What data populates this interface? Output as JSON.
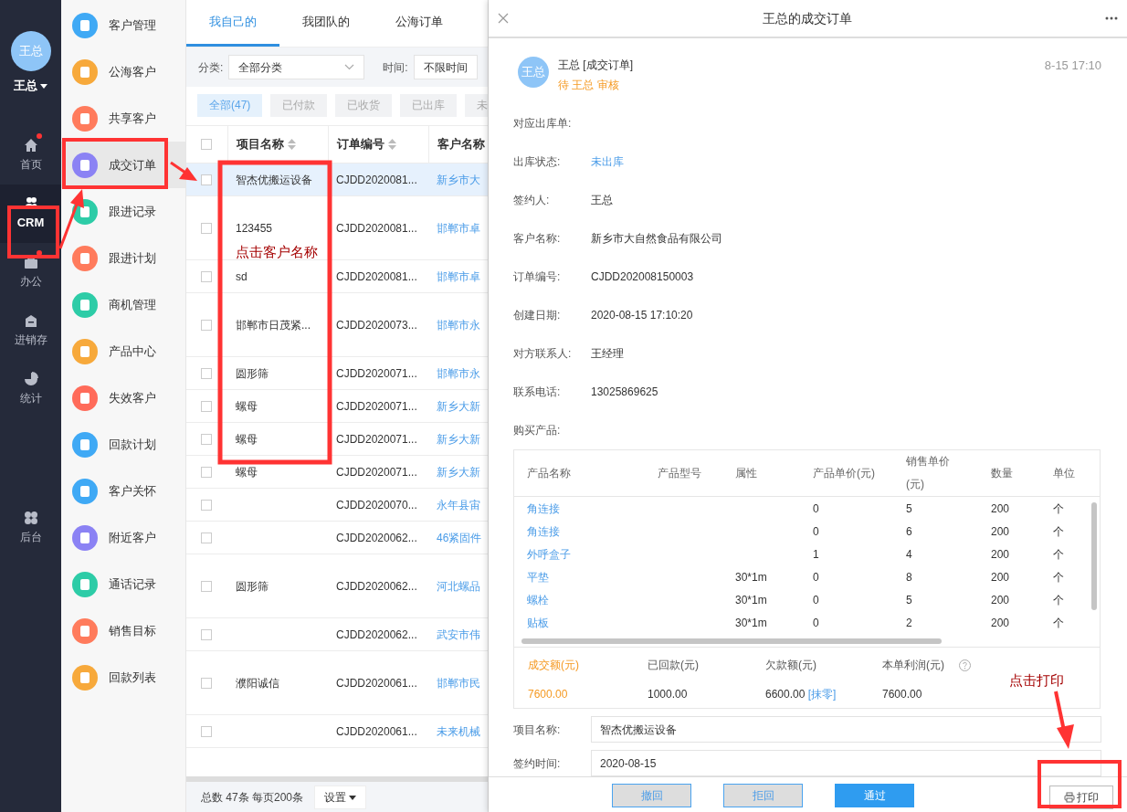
{
  "nav": {
    "avatar": "王总",
    "user": "王总",
    "items": [
      {
        "label": "首页",
        "selected": false,
        "dot": true
      },
      {
        "label": "CRM",
        "selected": true,
        "dot": false
      },
      {
        "label": "办公",
        "selected": false,
        "dot": true
      },
      {
        "label": "进销存",
        "selected": false,
        "dot": false
      },
      {
        "label": "统计",
        "selected": false,
        "dot": false
      },
      {
        "label": "后台",
        "selected": false,
        "dot": false
      }
    ]
  },
  "menu": [
    {
      "label": "客户管理",
      "color": "#3fa9f5",
      "selected": false
    },
    {
      "label": "公海客户",
      "color": "#f7a93b",
      "selected": false
    },
    {
      "label": "共享客户",
      "color": "#ff7b5c",
      "selected": false
    },
    {
      "label": "成交订单",
      "color": "#8b82f4",
      "selected": true
    },
    {
      "label": "跟进记录",
      "color": "#2dcca7",
      "selected": false
    },
    {
      "label": "跟进计划",
      "color": "#ff7b5c",
      "selected": false
    },
    {
      "label": "商机管理",
      "color": "#2dcca7",
      "selected": false
    },
    {
      "label": "产品中心",
      "color": "#f7a93b",
      "selected": false
    },
    {
      "label": "失效客户",
      "color": "#ff6b5a",
      "selected": false
    },
    {
      "label": "回款计划",
      "color": "#3fa9f5",
      "selected": false
    },
    {
      "label": "客户关怀",
      "color": "#3fa9f5",
      "selected": false
    },
    {
      "label": "附近客户",
      "color": "#8b82f4",
      "selected": false
    },
    {
      "label": "通话记录",
      "color": "#2dcca7",
      "selected": false
    },
    {
      "label": "销售目标",
      "color": "#ff7b5c",
      "selected": false
    },
    {
      "label": "回款列表",
      "color": "#f7a93b",
      "selected": false
    }
  ],
  "orders": {
    "tabs": [
      {
        "label": "我自己的",
        "selected": true
      },
      {
        "label": "我团队的",
        "selected": false
      },
      {
        "label": "公海订单",
        "selected": false
      }
    ],
    "filters": [
      {
        "kind": "select",
        "label": "分类:",
        "value": "全部分类"
      },
      {
        "kind": "input",
        "label": "时间:",
        "value": "不限时间"
      }
    ],
    "chips": [
      {
        "label": "全部(47)",
        "selected": true
      },
      {
        "label": "已付款",
        "selected": false
      },
      {
        "label": "已收货",
        "selected": false
      },
      {
        "label": "已出库",
        "selected": false
      },
      {
        "label": "未",
        "selected": false
      }
    ],
    "columns": [
      "项目名称",
      "订单编号",
      "客户名称"
    ],
    "all_checked": false,
    "rows": [
      {
        "name": "智杰优搬运设备",
        "order": "CJDD2020081...",
        "customer": "新乡市大",
        "selected": true,
        "checked": false
      },
      {
        "name": "123455",
        "order": "CJDD2020081...",
        "customer": "邯郸市卓",
        "selected": false,
        "checked": false
      },
      {
        "name": "sd",
        "order": "CJDD2020081...",
        "customer": "邯郸市卓",
        "selected": false,
        "checked": false
      },
      {
        "name": "邯郸市日茂紧...",
        "order": "CJDD2020073...",
        "customer": "邯郸市永",
        "selected": false,
        "checked": false
      },
      {
        "name": "圆形筛",
        "order": "CJDD2020071...",
        "customer": "邯郸市永",
        "selected": false,
        "checked": false
      },
      {
        "name": "螺母",
        "order": "CJDD2020071...",
        "customer": "新乡大新",
        "selected": false,
        "checked": false
      },
      {
        "name": "螺母",
        "order": "CJDD2020071...",
        "customer": "新乡大新",
        "selected": false,
        "checked": false
      },
      {
        "name": "螺母",
        "order": "CJDD2020071...",
        "customer": "新乡大新",
        "selected": false,
        "checked": false
      },
      {
        "order": "CJDD2020070...",
        "customer": "永年县宙",
        "selected": false,
        "checked": false
      },
      {
        "order": "CJDD2020062...",
        "customer": "46紧固件",
        "selected": false,
        "checked": false
      },
      {
        "name": "圆形筛",
        "order": "CJDD2020062...",
        "customer": "河北螺品",
        "selected": false,
        "checked": false
      },
      {
        "order": "CJDD2020062...",
        "customer": "武安市伟",
        "selected": false,
        "checked": false
      },
      {
        "name": "濮阳诚信",
        "order": "CJDD2020061...",
        "customer": "邯郸市民",
        "selected": false,
        "checked": false
      },
      {
        "order": "CJDD2020061...",
        "customer": "未来机械",
        "selected": false,
        "checked": false
      }
    ],
    "footer": {
      "summary": "总数 47条 每页200条",
      "settings": "设置"
    }
  },
  "panel": {
    "title": "王总的成交订单",
    "avatar": "王总",
    "author": "王总 [成交订单]",
    "status": "待 王总 审核",
    "time": "8-15 17:10",
    "fields": [
      {
        "label": "对应出库单:"
      },
      {
        "label": "出库状态:",
        "value": "未出库",
        "kind": "link"
      },
      {
        "label": "签约人:",
        "value": "王总",
        "kind": "text"
      },
      {
        "label": "客户名称:",
        "value": "新乡市大自然食品有限公司",
        "kind": "text"
      },
      {
        "label": "订单编号:",
        "value": "CJDD202008150003",
        "kind": "text"
      },
      {
        "label": "创建日期:",
        "value": "2020-08-15 17:10:20",
        "kind": "text"
      },
      {
        "label": "对方联系人:",
        "value": "王经理",
        "kind": "text"
      },
      {
        "label": "联系电话:",
        "value": "13025869625",
        "kind": "text"
      },
      {
        "label": "购买产品:"
      }
    ],
    "products": {
      "columns": [
        "产品名称",
        "产品型号",
        "属性",
        "产品单价(元)",
        "销售单价(元)",
        "数量",
        "单位"
      ],
      "rows": [
        [
          "角连接",
          "",
          "",
          "0",
          "5",
          "200",
          "个"
        ],
        [
          "角连接",
          "",
          "",
          "0",
          "6",
          "200",
          "个"
        ],
        [
          "外呼盒子",
          "",
          "",
          "1",
          "4",
          "200",
          "个"
        ],
        [
          "平垫",
          "",
          "30*1m",
          "0",
          "8",
          "200",
          "个"
        ],
        [
          "螺栓",
          "",
          "30*1m",
          "0",
          "5",
          "200",
          "个"
        ],
        [
          "贴板",
          "",
          "30*1m",
          "0",
          "2",
          "200",
          "个"
        ]
      ]
    },
    "totals": [
      {
        "label": "成交额(元)",
        "value": "7600.00",
        "highlight": true
      },
      {
        "label": "已回款(元)",
        "value": "1000.00",
        "highlight": false
      },
      {
        "label": "欠款额(元)",
        "value": "6600.00",
        "link": "[抹零]",
        "highlight": false
      },
      {
        "label": "本单利润(元)",
        "value": "7600.00",
        "help": true,
        "highlight": false
      }
    ],
    "inputs": [
      {
        "label": "项目名称:",
        "value": "智杰优搬运设备"
      },
      {
        "label": "签约时间:",
        "value": "2020-08-15"
      }
    ],
    "buttons": [
      {
        "label": "撤回",
        "kind": "gray"
      },
      {
        "label": "拒回",
        "kind": "gray"
      },
      {
        "label": "通过",
        "kind": "primary"
      },
      {
        "label": "打印",
        "kind": "print"
      }
    ]
  },
  "annotations": [
    "点击客户名称",
    "点击打印"
  ]
}
